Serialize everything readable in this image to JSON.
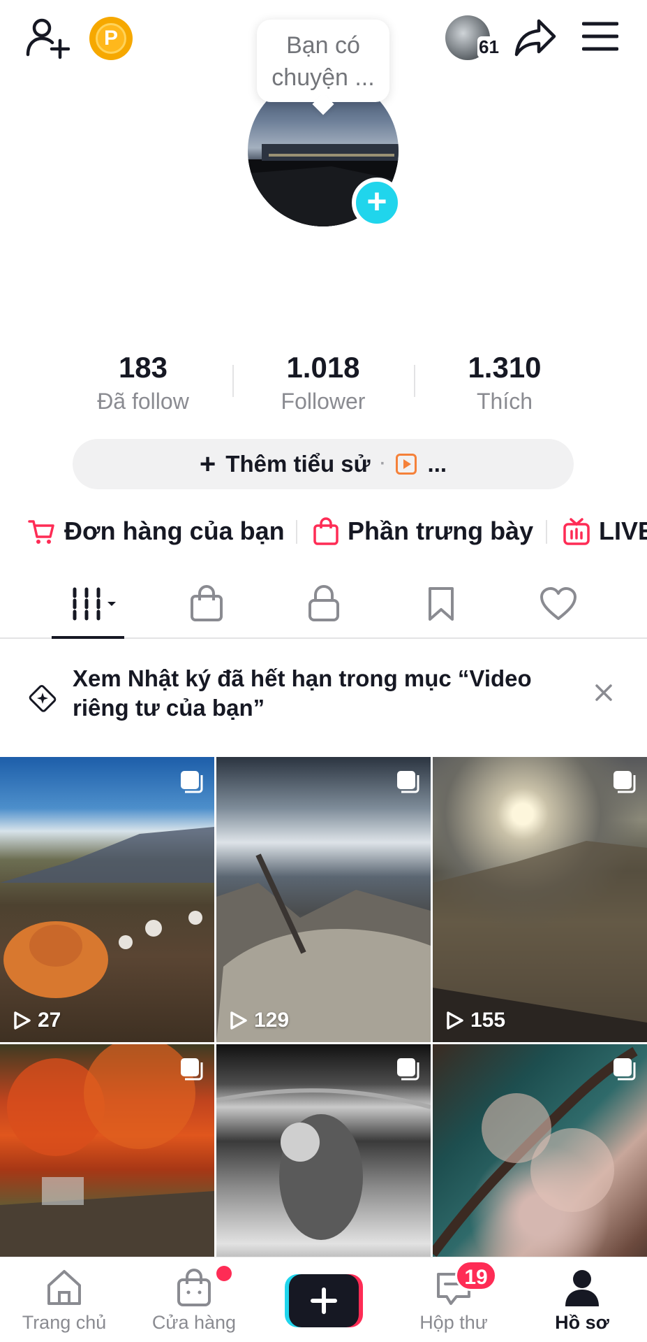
{
  "header": {
    "coin_letter": "P",
    "friends_count": "61",
    "tooltip_text_line1": "Bạn có",
    "tooltip_text_line2": "chuyện ..."
  },
  "stats": [
    {
      "value": "183",
      "label": "Đã follow"
    },
    {
      "value": "1.018",
      "label": "Follower"
    },
    {
      "value": "1.310",
      "label": "Thích"
    }
  ],
  "bio_button": {
    "plus": "+",
    "label": "Thêm tiểu sử",
    "separator": "·",
    "more": "..."
  },
  "shortcuts": [
    {
      "label": "Đơn hàng của bạn",
      "icon": "cart-icon"
    },
    {
      "label": "Phần trưng bày",
      "icon": "bag-icon"
    },
    {
      "label": "LIVE",
      "icon": "tv-icon"
    }
  ],
  "tabs": [
    {
      "name": "videos",
      "icon": "grid-icon",
      "active": true
    },
    {
      "name": "shop",
      "icon": "shopping-bag-icon"
    },
    {
      "name": "private",
      "icon": "lock-icon"
    },
    {
      "name": "saved",
      "icon": "bookmark-icon"
    },
    {
      "name": "liked",
      "icon": "heart-icon"
    }
  ],
  "notice": {
    "line1": "Xem Nhật ký đã hết hạn trong mục “Video",
    "line2": "riêng tư của bạn”"
  },
  "videos": [
    {
      "views": "27"
    },
    {
      "views": "129"
    },
    {
      "views": "155"
    },
    {
      "views": ""
    },
    {
      "views": ""
    },
    {
      "views": ""
    }
  ],
  "bottom_nav": {
    "home": "Trang chủ",
    "shop": "Cửa hàng",
    "create": "+",
    "inbox": "Hộp thư",
    "inbox_badge": "19",
    "profile": "Hồ sơ"
  },
  "colors": {
    "accent_red": "#fe2c55",
    "accent_cyan": "#20d5ec",
    "coin": "#ffb81c",
    "text_primary": "#161823",
    "text_secondary": "#8a8b91"
  }
}
